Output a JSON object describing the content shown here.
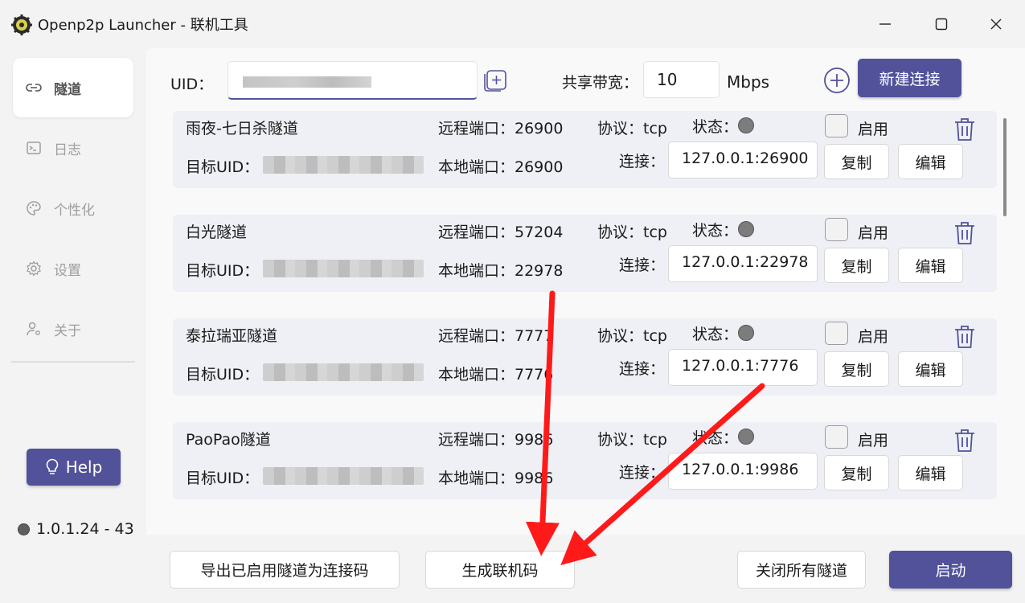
{
  "window": {
    "title": "Openp2p Launcher - 联机工具"
  },
  "sidebar": {
    "items": [
      {
        "label": "隧道",
        "icon": "link-icon",
        "active": true
      },
      {
        "label": "日志",
        "icon": "terminal-icon",
        "active": false
      },
      {
        "label": "个性化",
        "icon": "palette-icon",
        "active": false
      },
      {
        "label": "设置",
        "icon": "gear-icon",
        "active": false
      },
      {
        "label": "关于",
        "icon": "user-gear-icon",
        "active": false
      }
    ],
    "help_label": "Help",
    "version": "1.0.1.24 - 43"
  },
  "toolbar": {
    "uid_label": "UID：",
    "bandwidth_label": "共享带宽：",
    "bandwidth_value": "10",
    "bandwidth_unit": "Mbps",
    "new_connection_label": "新建连接"
  },
  "tunnels": [
    {
      "name": "雨夜-七日杀隧道",
      "remote_port": "远程端口：26900",
      "local_port": "本地端口：26900",
      "protocol": "协议：tcp",
      "status_label": "状态：",
      "enable_label": "启用",
      "target_uid_label": "目标UID：",
      "conn_label": "连接：",
      "conn": "127.0.0.1:26900",
      "copy_label": "复制",
      "edit_label": "编辑"
    },
    {
      "name": "白光隧道",
      "remote_port": "远程端口：57204",
      "local_port": "本地端口：22978",
      "protocol": "协议：tcp",
      "status_label": "状态：",
      "enable_label": "启用",
      "target_uid_label": "目标UID：",
      "conn_label": "连接：",
      "conn": "127.0.0.1:22978",
      "copy_label": "复制",
      "edit_label": "编辑"
    },
    {
      "name": "泰拉瑞亚隧道",
      "remote_port": "远程端口：7777",
      "local_port": "本地端口：7776",
      "protocol": "协议：tcp",
      "status_label": "状态：",
      "enable_label": "启用",
      "target_uid_label": "目标UID：",
      "conn_label": "连接：",
      "conn": "127.0.0.1:7776",
      "copy_label": "复制",
      "edit_label": "编辑"
    },
    {
      "name": "PaoPao隧道",
      "remote_port": "远程端口：9986",
      "local_port": "本地端口：9986",
      "protocol": "协议：tcp",
      "status_label": "状态：",
      "enable_label": "启用",
      "target_uid_label": "目标UID：",
      "conn_label": "连接：",
      "conn": "127.0.0.1:9986",
      "copy_label": "复制",
      "edit_label": "编辑"
    }
  ],
  "bottom": {
    "export_label": "导出已启用隧道为连接码",
    "generate_label": "生成联机码",
    "close_all_label": "关闭所有隧道",
    "start_label": "启动"
  },
  "colors": {
    "accent": "#51529a",
    "annotation_arrow": "#ff1a1a",
    "status_idle": "#7c7c7c"
  }
}
